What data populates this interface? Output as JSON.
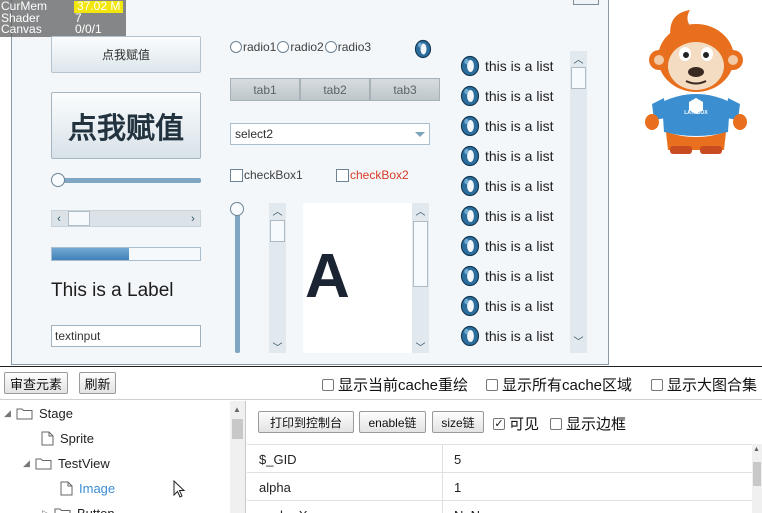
{
  "stats": {
    "rows": [
      {
        "key": "CurMem",
        "value": "37.02 M"
      },
      {
        "key": "Shader",
        "value": "7"
      },
      {
        "key": "Canvas",
        "value": "0/0/1"
      }
    ]
  },
  "stage": {
    "button_small_label": "点我赋值",
    "button_big_label": "点我赋值",
    "slider_value": 0,
    "progress_value": 0.52,
    "label_text": "This is a Label",
    "textinput_value": "textinput",
    "radios": [
      "radio1",
      "radio2",
      "radio3"
    ],
    "tabs": [
      "tab1",
      "tab2",
      "tab3"
    ],
    "select_value": "select2",
    "checkbox1_label": "checkBox1",
    "checkbox2_label": "checkBox2",
    "panel_text": "A",
    "list_items": [
      "this is a list",
      "this is a list",
      "this is a list",
      "this is a list",
      "this is a list",
      "this is a list",
      "this is a list",
      "this is a list",
      "this is a list",
      "this is a list"
    ]
  },
  "mascot": {
    "badge_text": "LAYABOX"
  },
  "toolbar": {
    "inspect_label": "审查元素",
    "refresh_label": "刷新",
    "opt_cache_redraw": "显示当前cache重绘",
    "opt_all_cache": "显示所有cache区域",
    "opt_big_atlas": "显示大图合集"
  },
  "tree": {
    "nodes": [
      {
        "label": "Stage",
        "depth": 0,
        "expanded": true,
        "type": "folder"
      },
      {
        "label": "Sprite",
        "depth": 1,
        "expanded": false,
        "type": "file"
      },
      {
        "label": "TestView",
        "depth": 1,
        "expanded": true,
        "type": "folder"
      },
      {
        "label": "Image",
        "depth": 2,
        "expanded": false,
        "type": "file",
        "selected": true
      },
      {
        "label": "Button",
        "depth": 2,
        "expanded": false,
        "type": "folder"
      }
    ]
  },
  "props": {
    "print_label": "打印到控制台",
    "enable_chain_label": "enable链",
    "size_chain_label": "size链",
    "visible_label": "可见",
    "visible_checked": true,
    "show_border_label": "显示边框",
    "show_border_checked": false,
    "rows": [
      {
        "key": "$_GID",
        "value": "5"
      },
      {
        "key": "alpha",
        "value": "1"
      },
      {
        "key": "anchorX",
        "value": "NaN"
      }
    ]
  },
  "colors": {
    "accent_blue": "#3f81b8",
    "selected_node": "#3a8ed8",
    "checkbox2_text": "#d93a26",
    "mascot_orange": "#e86f1d",
    "mascot_shirt": "#3b8fd1"
  }
}
